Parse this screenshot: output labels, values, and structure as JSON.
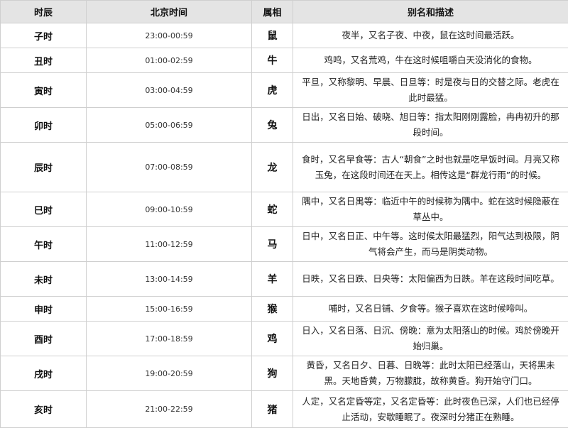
{
  "table": {
    "headers": [
      "时辰",
      "北京时间",
      "属相",
      "别名和描述"
    ],
    "rows": [
      {
        "shichen": "子时",
        "time": "23:00-00:59",
        "zodiac": "鼠",
        "desc": "夜半，又名子夜、中夜，鼠在这时间最活跃。"
      },
      {
        "shichen": "丑时",
        "time": "01:00-02:59",
        "zodiac": "牛",
        "desc": "鸡鸣，又名荒鸡，牛在这时候咀嚼白天没消化的食物。"
      },
      {
        "shichen": "寅时",
        "time": "03:00-04:59",
        "zodiac": "虎",
        "desc": "平旦，又称黎明、早晨、日旦等：时是夜与日的交替之际。老虎在此时最猛。"
      },
      {
        "shichen": "卯时",
        "time": "05:00-06:59",
        "zodiac": "兔",
        "desc": "日出，又名日始、破晓、旭日等：指太阳刚刚露脸，冉冉初升的那段时间。"
      },
      {
        "shichen": "辰时",
        "time": "07:00-08:59",
        "zodiac": "龙",
        "desc": "食时，又名早食等：古人“朝食”之时也就是吃早饭时间。月亮又称玉兔，在这段时间还在天上。相传这是“群龙行雨”的时候。"
      },
      {
        "shichen": "巳时",
        "time": "09:00-10:59",
        "zodiac": "蛇",
        "desc": "隅中，又名日禺等：临近中午的时候称为隅中。蛇在这时候隐蔽在草丛中。"
      },
      {
        "shichen": "午时",
        "time": "11:00-12:59",
        "zodiac": "马",
        "desc": "日中，又名日正、中午等。这时候太阳最猛烈，阳气达到极限，阴气将会产生，而马是阴类动物。"
      },
      {
        "shichen": "未时",
        "time": "13:00-14:59",
        "zodiac": "羊",
        "desc": "日昳，又名日跌、日央等：太阳偏西为日跌。羊在这段时间吃草。"
      },
      {
        "shichen": "申时",
        "time": "15:00-16:59",
        "zodiac": "猴",
        "desc": "哺时，又名日铺、夕食等。猴子喜欢在这时候啼叫。"
      },
      {
        "shichen": "酉时",
        "time": "17:00-18:59",
        "zodiac": "鸡",
        "desc": "日入，又名日落、日沉、傍晚：意为太阳落山的时候。鸡於傍晚开始归巢。"
      },
      {
        "shichen": "戌时",
        "time": "19:00-20:59",
        "zodiac": "狗",
        "desc": "黄昏，又名日夕、日暮、日晚等：此时太阳已经落山，天将黑未黑。天地昏黄，万物朦胧，故称黄昏。狗开始守门口。"
      },
      {
        "shichen": "亥时",
        "time": "21:00-22:59",
        "zodiac": "猪",
        "desc": "人定，又名定昏等定，又名定昏等：此时夜色已深，人们也已经停止活动，安歇睡眠了。夜深时分猪正在熟睡。"
      }
    ]
  }
}
